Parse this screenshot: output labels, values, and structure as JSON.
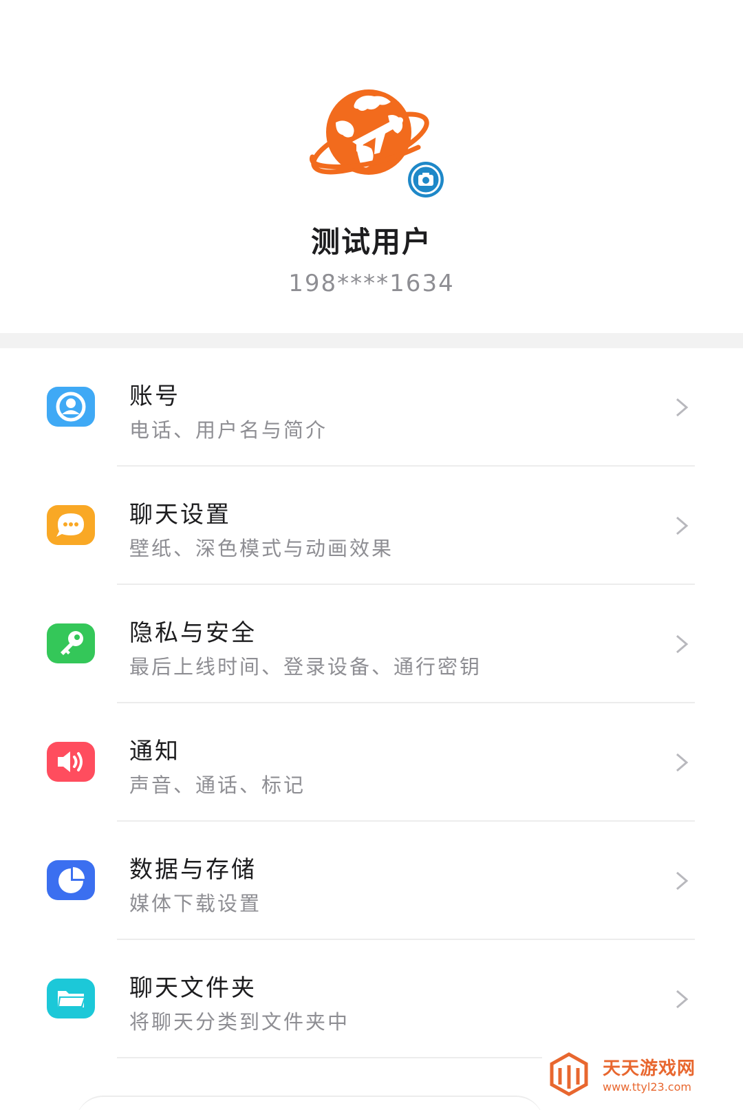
{
  "profile": {
    "name": "测试用户",
    "phone": "198****1634"
  },
  "icons": {
    "search": "search-icon",
    "camera": "camera-icon",
    "chevron": "chevron-right-icon"
  },
  "menu": [
    {
      "title": "账号",
      "subtitle": "电话、用户名与简介",
      "icon": "account-icon",
      "color": "#3fa9f5"
    },
    {
      "title": "聊天设置",
      "subtitle": "壁纸、深色模式与动画效果",
      "icon": "chat-bubble-icon",
      "color": "#f9a825"
    },
    {
      "title": "隐私与安全",
      "subtitle": "最后上线时间、登录设备、通行密钥",
      "icon": "key-icon",
      "color": "#34c759"
    },
    {
      "title": "通知",
      "subtitle": "声音、通话、标记",
      "icon": "speaker-icon",
      "color": "#ff4d5e"
    },
    {
      "title": "数据与存储",
      "subtitle": "媒体下载设置",
      "icon": "pie-chart-icon",
      "color": "#3b6ff0"
    },
    {
      "title": "聊天文件夹",
      "subtitle": "将聊天分类到文件夹中",
      "icon": "folder-icon",
      "color": "#1cc8d8"
    }
  ],
  "watermark": {
    "name": "天天游戏网",
    "url": "www.ttyl23.com",
    "color": "#e8672f"
  },
  "colors": {
    "avatar": "#f26b1d",
    "camera_badge": "#1e88c8"
  }
}
